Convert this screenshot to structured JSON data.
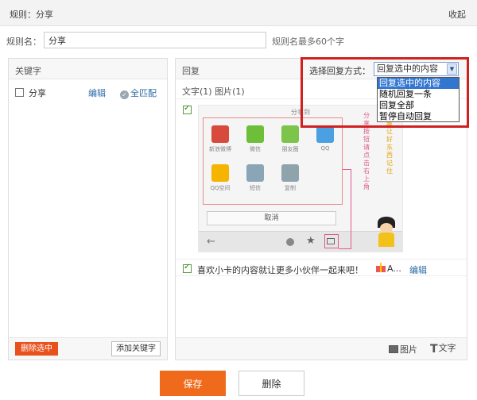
{
  "header": {
    "title": "规则：分享",
    "collapse_label": "收起"
  },
  "rule": {
    "label": "规则名：",
    "value": "分享",
    "hint": "规则名最多60个字"
  },
  "keywords": {
    "title": "关键字",
    "items": [
      {
        "text": "分享",
        "checked": false,
        "edit_label": "编辑",
        "match_label": "全匹配"
      }
    ],
    "delete_selected_label": "删除选中",
    "add_keyword_label": "添加关键字"
  },
  "reply": {
    "title": "回复",
    "mode_label": "选择回复方式：",
    "mode_selected": "回复选中的内容",
    "mode_options": [
      "回复选中的内容",
      "随机回复一条",
      "回复全部",
      "暂停自动回复"
    ],
    "summary": "文字(1) 图片(1)",
    "image_item": {
      "checked": true,
      "share_title": "分享到",
      "share_icons": [
        {
          "label": "新浪微博",
          "color": "#d84a3c"
        },
        {
          "label": "微信",
          "color": "#6dbf3a"
        },
        {
          "label": "朋友圈",
          "color": "#7cc44a"
        },
        {
          "label": "QQ",
          "color": "#4aa0e0"
        },
        {
          "label": "QQ空间",
          "color": "#f4b400"
        },
        {
          "label": "短信",
          "color": "#8aa6b6"
        },
        {
          "label": "复制",
          "color": "#8fa3ad"
        }
      ],
      "cancel_label": "取消",
      "side_text_1": "分享按钮请点击右上角",
      "side_text_2": "收藏让好东西记住"
    },
    "text_item": {
      "checked": true,
      "text": "喜欢小卡的内容就让更多小伙伴一起来吧！",
      "attach_label": "A...",
      "edit_label": "编辑"
    },
    "image_button_label": "图片",
    "text_button_label": "文字"
  },
  "footer": {
    "save_label": "保存",
    "delete_label": "删除"
  },
  "colors": {
    "accent": "#f06a1c",
    "link": "#2a6ba6",
    "highlight": "#d02020",
    "select_active": "#3376d0"
  }
}
